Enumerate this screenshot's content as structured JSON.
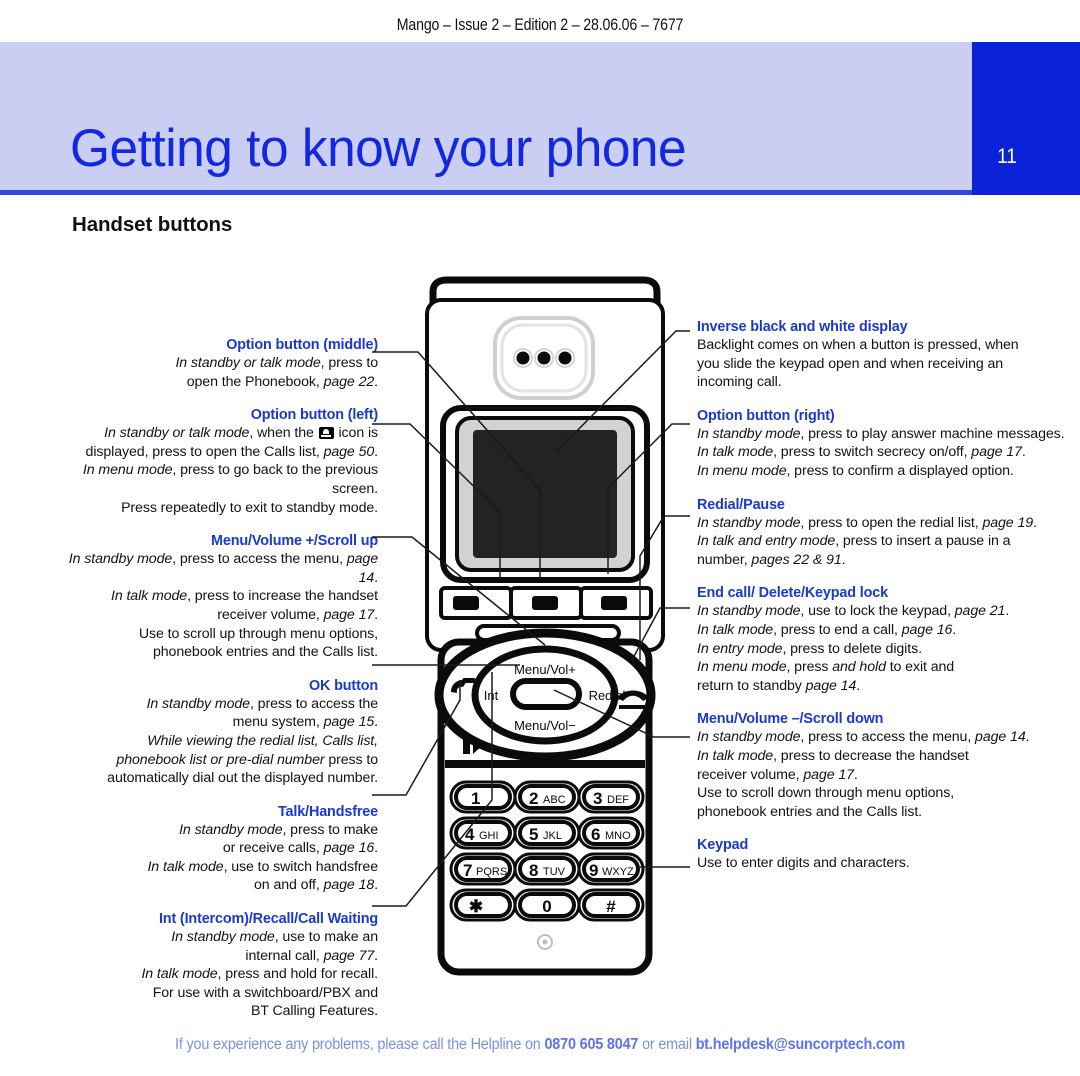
{
  "header": {
    "running_head": "Mango – Issue 2 – Edition 2 – 28.06.06 – 7677",
    "title": "Getting to know your phone",
    "page_number": "11"
  },
  "section": {
    "heading": "Handset buttons"
  },
  "left_column": [
    {
      "title": "Option button (middle)",
      "lines": [
        "<i>In standby or talk mode</i>, press to",
        "open the Phonebook, <i>page 22</i>."
      ]
    },
    {
      "title": "Option button (left)",
      "lines": [
        "<i>In standby or talk mode</i>, when the <span class=\"phone-glyph\"></span> icon is",
        "displayed, press to open the Calls list, <i>page 50</i>.",
        "<i>In menu mode</i>, press to go back to the previous screen.",
        "Press repeatedly to exit to standby mode."
      ]
    },
    {
      "title": "Menu/Volume +/Scroll up",
      "lines": [
        "<i>In standby mode</i>, press to access the menu, <i>page 14</i>.",
        "<i>In talk mode</i>, press to increase the handset",
        "receiver volume, <i>page 17</i>.",
        "Use to scroll up through menu options,",
        "phonebook entries and the Calls list."
      ]
    },
    {
      "title": "OK button",
      "lines": [
        "<i>In standby mode</i>, press to access the",
        "menu system, <i>page 15</i>.",
        "<i>While viewing the redial list, Calls list,</i>",
        "<i>phonebook list or pre-dial number</i> press to",
        "automatically dial out the displayed number."
      ]
    },
    {
      "title": "Talk/Handsfree",
      "lines": [
        "<i>In standby mode</i>, press to make",
        "or receive calls, <i>page 16</i>.",
        "<i>In talk mode</i>, use to switch handsfree",
        "on and off, <i>page 18</i>."
      ]
    },
    {
      "title": "Int (Intercom)/Recall/Call Waiting",
      "lines": [
        "<i>In standby mode</i>, use to make an",
        "internal call, <i>page 77</i>.",
        "<i>In talk mode</i>, press and hold for recall.",
        "For use with a switchboard/PBX and",
        "BT Calling Features."
      ]
    }
  ],
  "right_column": [
    {
      "title": "Inverse black and white display",
      "lines": [
        "Backlight comes on when a button is pressed, when",
        "you slide the keypad open and when receiving an",
        "incoming call."
      ]
    },
    {
      "title": "Option button (right)",
      "lines": [
        "<i>In standby mode</i>, press to play answer machine messages.",
        "<i>In talk mode</i>, press to switch secrecy on/off, <i>page 17</i>.",
        "<i>In menu mode</i>, press to confirm a displayed option."
      ]
    },
    {
      "title": "Redial/Pause",
      "lines": [
        "<i>In standby mode</i>, press to open the redial list, <i>page 19</i>.",
        "<i>In talk and entry mode</i>, press to insert a pause in a",
        "number, <i>pages 22 &amp; 91</i>."
      ]
    },
    {
      "title": "End call/ Delete/Keypad lock",
      "lines": [
        "<i>In standby mode</i>, use to lock the keypad, <i>page 21</i>.",
        "<i>In talk mode</i>, press to end a call, <i>page 16</i>.",
        "<i>In entry mode</i>, press to delete digits.",
        "<i>In menu mode</i>, press <i>and hold</i> to exit and",
        "return to standby <i>page 14</i>."
      ]
    },
    {
      "title": "Menu/Volume –/Scroll down",
      "lines": [
        "<i>In standby mode</i>, press to access the menu, <i>page 14</i>.",
        "<i>In talk mode</i>, press to decrease the handset",
        "receiver volume, <i>page 17</i>.",
        "Use to scroll down through menu options,",
        "phonebook entries and the Calls list."
      ]
    },
    {
      "title": "Keypad",
      "lines": [
        "Use to enter digits and characters."
      ]
    }
  ],
  "phone": {
    "nav_labels": {
      "up": "Menu/Vol+",
      "down": "Menu/Vol−",
      "left": "Int",
      "right": "Redial"
    },
    "keypad": [
      {
        "digit": "1",
        "letters": ""
      },
      {
        "digit": "2",
        "letters": "ABC"
      },
      {
        "digit": "3",
        "letters": "DEF"
      },
      {
        "digit": "4",
        "letters": "GHI"
      },
      {
        "digit": "5",
        "letters": "JKL"
      },
      {
        "digit": "6",
        "letters": "MNO"
      },
      {
        "digit": "7",
        "letters": "PQRS"
      },
      {
        "digit": "8",
        "letters": "TUV"
      },
      {
        "digit": "9",
        "letters": "WXYZ"
      },
      {
        "digit": "✱",
        "letters": ""
      },
      {
        "digit": "0",
        "letters": ""
      },
      {
        "digit": "#",
        "letters": ""
      }
    ]
  },
  "footer": {
    "prefix": "If you experience any problems, please call the Helpline on ",
    "phone": "0870 605 8047",
    "middle": " or email ",
    "email": "bt.helpdesk@suncorptech.com"
  },
  "colors": {
    "banner_bg": "#c9cef2",
    "title_blue": "#1227e2",
    "tab_blue": "#0a22d8",
    "heading_blue": "#1a38d2",
    "footer_blue": "#7d8cf0",
    "rule_blue": "#3148e2"
  }
}
